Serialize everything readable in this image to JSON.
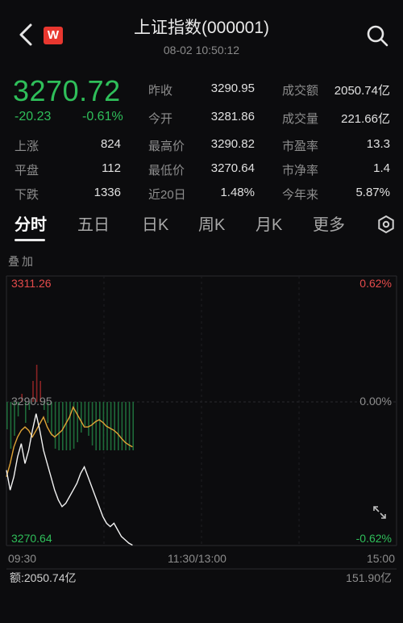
{
  "header": {
    "title": "上证指数(000001)",
    "datetime": "08-02 10:50:12",
    "logo_text": "W"
  },
  "quote": {
    "price": "3270.72",
    "change": "-20.23",
    "change_pct": "-0.61%"
  },
  "stats": {
    "prev_close_label": "昨收",
    "prev_close": "3290.95",
    "open_label": "今开",
    "open": "3281.86",
    "high_label": "最高价",
    "high": "3290.82",
    "low_label": "最低价",
    "low": "3270.64",
    "d20_label": "近20日",
    "d20": "1.48%",
    "turnover_label": "成交额",
    "turnover": "2050.74亿",
    "volume_label": "成交量",
    "volume": "221.66亿",
    "pe_label": "市盈率",
    "pe": "13.3",
    "pb_label": "市净率",
    "pb": "1.4",
    "ytd_label": "今年来",
    "ytd": "5.87%",
    "up_label": "上涨",
    "up": "824",
    "flat_label": "平盘",
    "flat": "112",
    "down_label": "下跌",
    "down": "1336"
  },
  "tabs": [
    "分时",
    "五日",
    "日K",
    "周K",
    "月K",
    "更多"
  ],
  "overlay_label": "叠加",
  "chart_data": {
    "type": "line",
    "y_top": "3311.26",
    "y_mid": "3290.95",
    "y_bottom": "3270.64",
    "pct_top": "0.62%",
    "pct_mid": "0.00%",
    "pct_bottom": "-0.62%",
    "x_start": "09:30",
    "x_mid": "11:30/13:00",
    "x_end": "15:00",
    "ylim": [
      3270.64,
      3311.26
    ],
    "price_series": [
      3282,
      3279,
      3281,
      3284,
      3286,
      3283,
      3285,
      3288,
      3290.5,
      3288,
      3285,
      3283,
      3281,
      3279,
      3277.5,
      3276.5,
      3277,
      3278,
      3279,
      3280,
      3281.5,
      3282.5,
      3281,
      3279.5,
      3278,
      3276.5,
      3275,
      3274,
      3273.5,
      3274,
      3273,
      3272,
      3271.5,
      3271,
      3270.7
    ],
    "avg_series": [
      3281,
      3283,
      3285.5,
      3287,
      3288,
      3288.5,
      3288,
      3287,
      3288,
      3289,
      3290,
      3288.5,
      3287.5,
      3287,
      3287.5,
      3288,
      3289,
      3290,
      3291.5,
      3290.5,
      3289.5,
      3288.5,
      3288.5,
      3288.8,
      3289.3,
      3289.6,
      3289.2,
      3288.6,
      3288.3,
      3288,
      3287.5,
      3286.8,
      3286.2,
      3285.8,
      3285.5
    ],
    "volume_total_label": "额:2050.74亿",
    "volume_right_label": "151.90亿"
  }
}
